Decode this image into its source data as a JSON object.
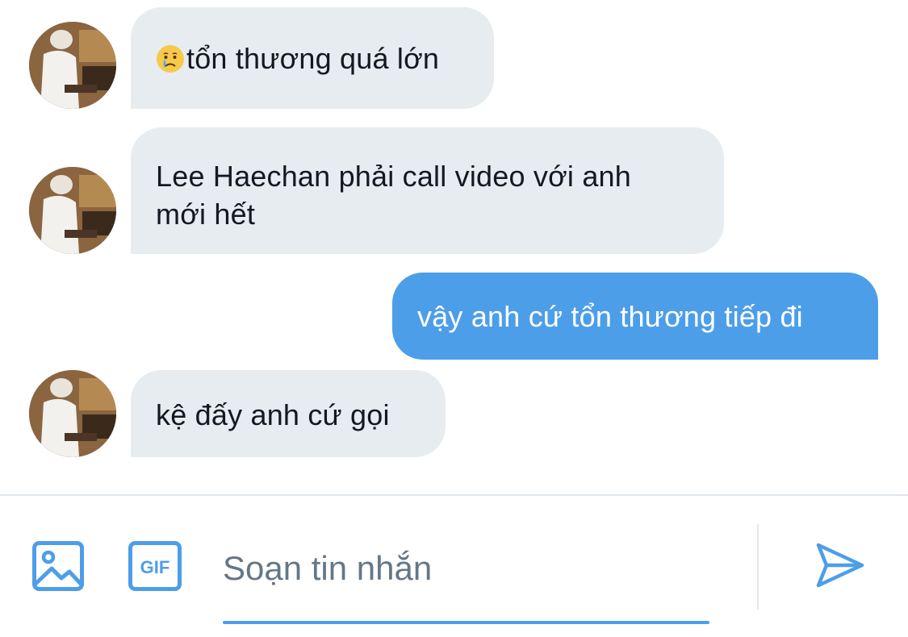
{
  "messages": [
    {
      "direction": "in",
      "emoji": "crying-face",
      "text": "tổn thương quá lớn"
    },
    {
      "direction": "in",
      "text_line1": "Lee Haechan phải call video với anh",
      "text_line2": "mới hết"
    },
    {
      "direction": "out",
      "text": "vậy anh cứ tổn thương tiếp đi"
    },
    {
      "direction": "in",
      "text": "kệ đấy anh cứ gọi"
    }
  ],
  "composer": {
    "placeholder": "Soạn tin nhắn",
    "value": "",
    "gif_label": "GIF",
    "icons": [
      "image-icon",
      "gif-icon",
      "send-icon"
    ]
  },
  "colors": {
    "incoming_bubble": "#e6ecf0",
    "outgoing_bubble": "#4d9ee9",
    "accent": "#4d9ee9",
    "placeholder": "#657786"
  }
}
